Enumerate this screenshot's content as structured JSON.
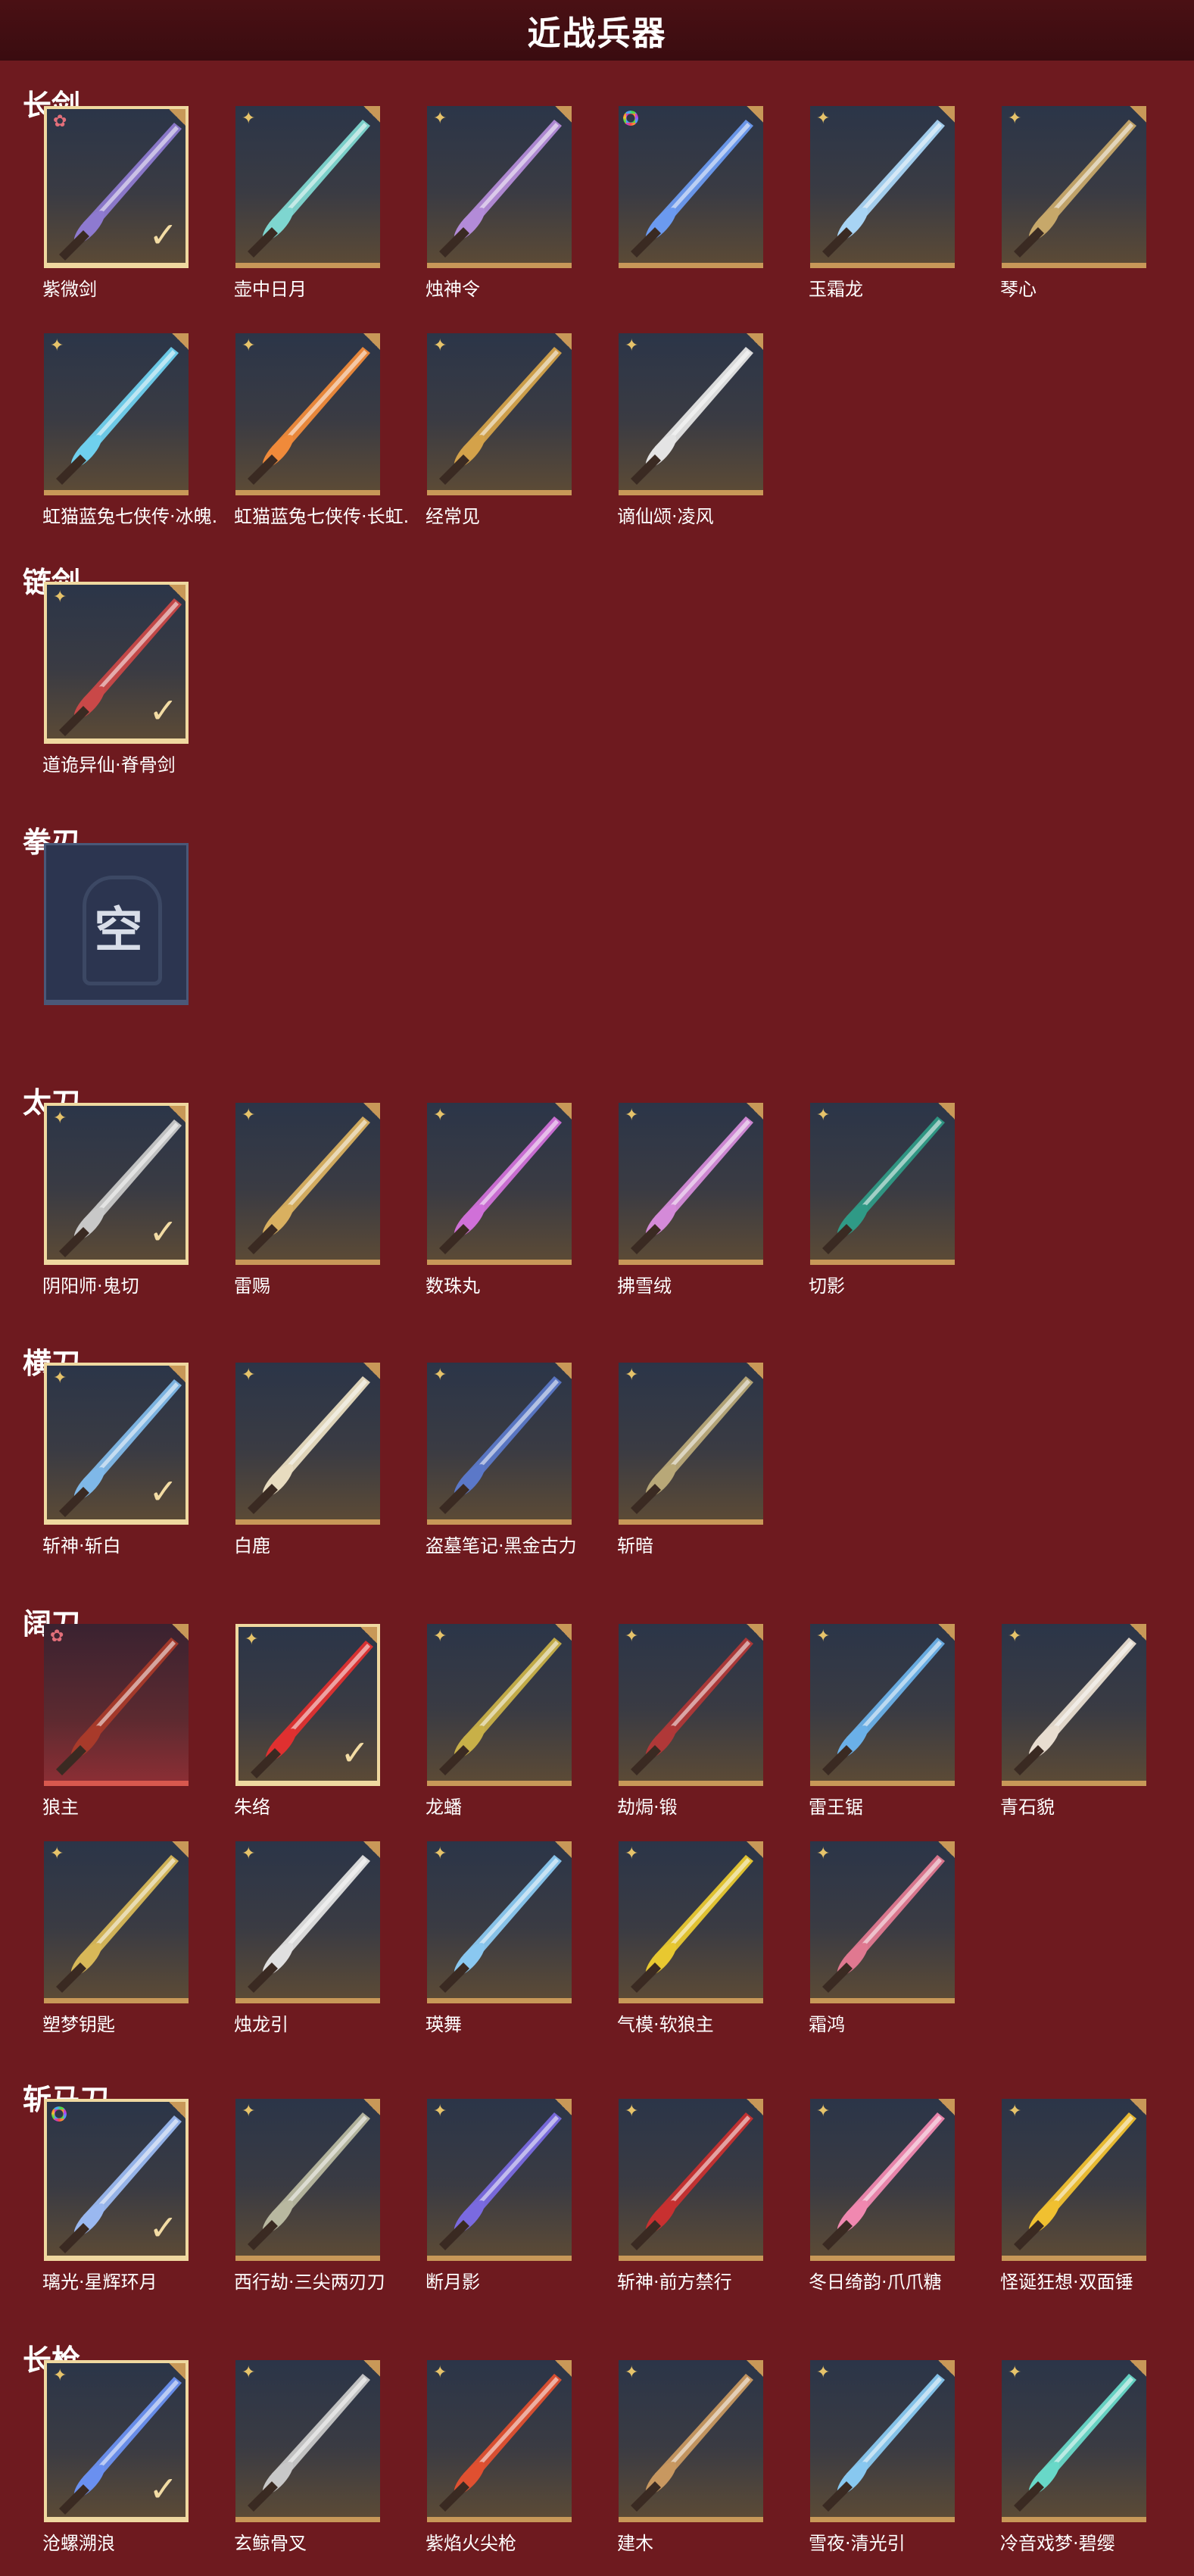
{
  "title": "近战兵器",
  "sections": [
    {
      "title": "长剑",
      "items": [
        {
          "name": "紫微剑",
          "badge": "pink",
          "selected": true,
          "color": "#8e7ad0"
        },
        {
          "name": "壶中日月",
          "badge": "gold",
          "selected": false,
          "color": "#7ed6d0"
        },
        {
          "name": "烛神令",
          "badge": "gold",
          "selected": false,
          "color": "#b38bd8"
        },
        {
          "name": "",
          "badge": "rainbow",
          "selected": false,
          "color": "#6b9af0"
        },
        {
          "name": "玉霜龙",
          "badge": "gold",
          "selected": false,
          "color": "#a8d4f4"
        },
        {
          "name": "琴心",
          "badge": "gold",
          "selected": false,
          "color": "#c7a86a"
        },
        {
          "name": "虹猫蓝兔七侠传·冰魄.",
          "badge": "gold",
          "selected": false,
          "color": "#6fd0ee"
        },
        {
          "name": "虹猫蓝兔七侠传·长虹.",
          "badge": "gold",
          "selected": false,
          "color": "#f08a3a"
        },
        {
          "name": "经常见",
          "badge": "gold",
          "selected": false,
          "color": "#d4a24a"
        },
        {
          "name": "谪仙颂·凌风",
          "badge": "gold",
          "selected": false,
          "color": "#e4e4e4"
        }
      ]
    },
    {
      "title": "链剑",
      "items": [
        {
          "name": "道诡异仙·脊骨剑",
          "badge": "gold",
          "selected": true,
          "color": "#c94848"
        }
      ]
    },
    {
      "title": "拳刃",
      "items": [
        {
          "name": "",
          "badge": "none",
          "selected": false,
          "empty": true,
          "empty_text": "空"
        }
      ]
    },
    {
      "title": "太刀",
      "items": [
        {
          "name": "阴阳师·鬼切",
          "badge": "gold",
          "selected": true,
          "color": "#c8c8c8"
        },
        {
          "name": "雷赐",
          "badge": "gold",
          "selected": false,
          "color": "#d9b060"
        },
        {
          "name": "数珠丸",
          "badge": "gold",
          "selected": false,
          "color": "#d070d8"
        },
        {
          "name": "拂雪绒",
          "badge": "gold",
          "selected": false,
          "color": "#d48ad8"
        },
        {
          "name": "切影",
          "badge": "gold",
          "selected": false,
          "color": "#2f9a86"
        }
      ]
    },
    {
      "title": "横刀",
      "items": [
        {
          "name": "斩神·斩白",
          "badge": "gold",
          "selected": true,
          "color": "#7fb8e8"
        },
        {
          "name": "白鹿",
          "badge": "gold",
          "selected": false,
          "color": "#e8dcc0"
        },
        {
          "name": "盗墓笔记·黑金古力",
          "badge": "gold",
          "selected": false,
          "color": "#5b78c8"
        },
        {
          "name": "斩暗",
          "badge": "gold",
          "selected": false,
          "color": "#b8a878"
        }
      ]
    },
    {
      "title": "阔刀",
      "items": [
        {
          "name": "狼主",
          "badge": "pink",
          "selected": false,
          "red": true,
          "color": "#a83a2a"
        },
        {
          "name": "朱络",
          "badge": "gold",
          "selected": true,
          "color": "#e03030"
        },
        {
          "name": "龙蟠",
          "badge": "gold",
          "selected": false,
          "color": "#c8b048"
        },
        {
          "name": "劫焗·锻",
          "badge": "gold",
          "selected": false,
          "color": "#b03838"
        },
        {
          "name": "雷王锯",
          "badge": "gold",
          "selected": false,
          "color": "#6ab0e8"
        },
        {
          "name": "青石貌",
          "badge": "gold",
          "selected": false,
          "color": "#e8ddd0"
        },
        {
          "name": "塑梦钥匙",
          "badge": "gold",
          "selected": false,
          "color": "#d8b858"
        },
        {
          "name": "烛龙引",
          "badge": "gold",
          "selected": false,
          "color": "#e0e0e0"
        },
        {
          "name": "瑛舞",
          "badge": "gold",
          "selected": false,
          "color": "#8ac8f0"
        },
        {
          "name": "气模·软狼主",
          "badge": "gold",
          "selected": false,
          "color": "#e8c830"
        },
        {
          "name": "霜鸿",
          "badge": "gold",
          "selected": false,
          "color": "#e07890"
        }
      ]
    },
    {
      "title": "斩马刀",
      "items": [
        {
          "name": "璃光·星辉环月",
          "badge": "rainbow",
          "selected": true,
          "color": "#9ab8f0"
        },
        {
          "name": "西行劫·三尖两刃刀",
          "badge": "gold",
          "selected": false,
          "color": "#b8b8a0"
        },
        {
          "name": "断月影",
          "badge": "gold",
          "selected": false,
          "color": "#7a6ae0"
        },
        {
          "name": "斩神·前方禁行",
          "badge": "gold",
          "selected": false,
          "color": "#c83030"
        },
        {
          "name": "冬日绮韵·爪爪糖",
          "badge": "gold",
          "selected": false,
          "color": "#f088b0"
        },
        {
          "name": "怪诞狂想·双面锤",
          "badge": "gold",
          "selected": false,
          "color": "#f0c030"
        }
      ]
    },
    {
      "title": "长枪",
      "items": [
        {
          "name": "沧螺溯浪",
          "badge": "gold",
          "selected": true,
          "color": "#6a90f0"
        },
        {
          "name": "玄鲸骨叉",
          "badge": "gold",
          "selected": false,
          "color": "#c8c8c8"
        },
        {
          "name": "紫焰火尖枪",
          "badge": "gold",
          "selected": false,
          "color": "#e05030"
        },
        {
          "name": "建木",
          "badge": "gold",
          "selected": false,
          "color": "#c89860"
        },
        {
          "name": "雪夜·清光引",
          "badge": "gold",
          "selected": false,
          "color": "#88c8f0"
        },
        {
          "name": "冷音戏梦·碧缨",
          "badge": "gold",
          "selected": false,
          "color": "#68d8c8"
        }
      ]
    }
  ]
}
